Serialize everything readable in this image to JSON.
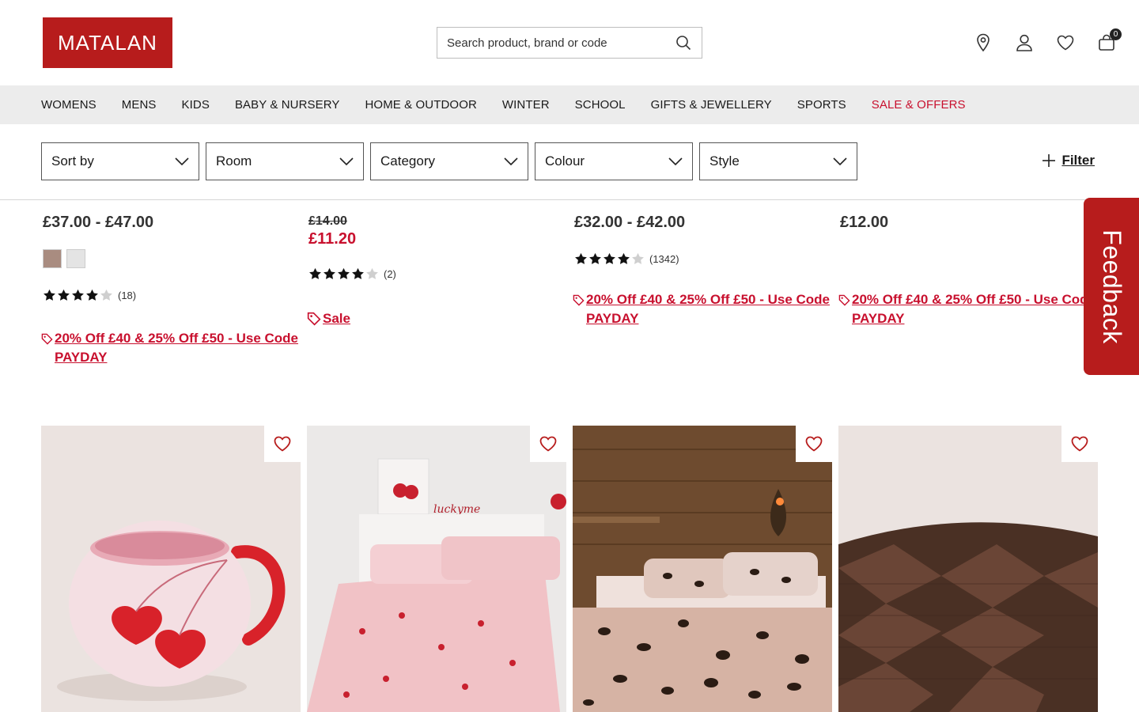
{
  "brand": {
    "logo_text": "MATALAN",
    "color": "#b71c1c"
  },
  "search": {
    "placeholder": "Search product, brand or code"
  },
  "header_icons": {
    "store": "location-pin-icon",
    "account": "user-icon",
    "wishlist": "heart-icon",
    "bag": "bag-icon",
    "bag_count": "0"
  },
  "nav": {
    "items": [
      "WOMENS",
      "MENS",
      "KIDS",
      "BABY & NURSERY",
      "HOME & OUTDOOR",
      "WINTER",
      "SCHOOL",
      "GIFTS & JEWELLERY",
      "SPORTS",
      "SALE & OFFERS"
    ]
  },
  "filters": {
    "dropdowns": [
      "Sort by",
      "Room",
      "Category",
      "Colour",
      "Style"
    ],
    "filter_label": "Filter"
  },
  "products_top": [
    {
      "price": "£37.00 - £47.00",
      "swatches": [
        "#a98c80",
        "#e4e4e4"
      ],
      "stars": 4,
      "reviews": "(18)",
      "promo": "20% Off £40 & 25% Off £50 - Use Code PAYDAY"
    },
    {
      "was_price": "£14.00",
      "now_price": "£11.20",
      "stars": 4,
      "reviews": "(2)",
      "promo": "Sale"
    },
    {
      "price": "£32.00 - £42.00",
      "stars": 4,
      "reviews": "(1342)",
      "promo": "20% Off £40 & 25% Off £50 - Use Code PAYDAY"
    },
    {
      "price": "£12.00",
      "promo": "20% Off £40 & 25% Off £50 - Use Code PAYDAY"
    }
  ],
  "feedback": {
    "label": "Feedback"
  },
  "products_bottom": [
    {
      "image": "cherry-heart-mug"
    },
    {
      "image": "valentine-print-bedding"
    },
    {
      "image": "leopard-print-bedding"
    },
    {
      "image": "woven-brown-basket"
    }
  ],
  "accent_color": "#c8102e"
}
